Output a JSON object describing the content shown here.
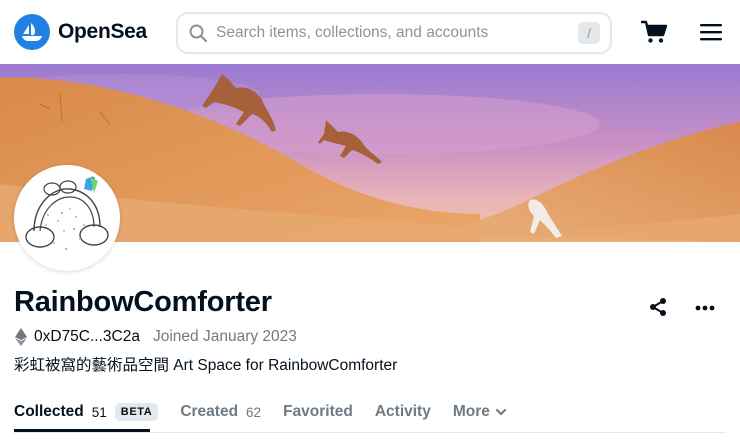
{
  "header": {
    "brand": "OpenSea",
    "search_placeholder": "Search items, collections, and accounts",
    "search_shortcut": "/",
    "icons": [
      "opensea-logo-icon",
      "search-icon",
      "cart-icon",
      "hamburger-menu-icon"
    ]
  },
  "profile": {
    "name": "RainbowComforter",
    "address": "0xD75C...3C2a",
    "joined": "Joined January 2023",
    "bio": "彩虹被窩的藝術品空間 Art Space for RainbowComforter"
  },
  "tabs": [
    {
      "label": "Collected",
      "count": "51",
      "badge": "BETA",
      "active": true
    },
    {
      "label": "Created",
      "count": "62",
      "active": false
    },
    {
      "label": "Favorited",
      "active": false
    },
    {
      "label": "Activity",
      "active": false
    },
    {
      "label": "More",
      "active": false
    }
  ],
  "colors": {
    "brand_blue": "#2081e2",
    "text_primary": "#04111d",
    "text_secondary": "#707a83",
    "border": "#e5e8eb"
  }
}
